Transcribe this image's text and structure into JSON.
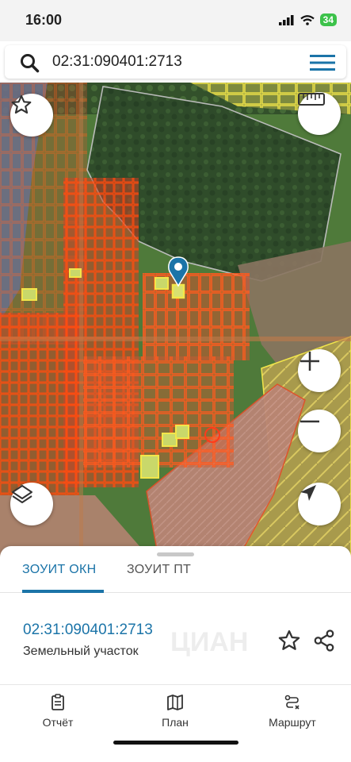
{
  "status_bar": {
    "time": "16:00",
    "battery": "34"
  },
  "search": {
    "query": "02:31:090401:2713"
  },
  "map": {
    "icons": [
      "star-icon",
      "ruler-icon",
      "zoom-in-icon",
      "zoom-out-icon",
      "layers-icon",
      "navigation-icon",
      "location-pin-icon"
    ]
  },
  "sheet": {
    "tabs": [
      {
        "label": "ЗОУИТ ОКН"
      },
      {
        "label": "ЗОУИТ ПТ"
      }
    ],
    "parcel": {
      "number": "02:31:090401:2713",
      "type": "Земельный участок"
    },
    "watermark": "ЦИАН"
  },
  "bottom_nav": [
    {
      "label": "Отчёт",
      "icon": "report-icon"
    },
    {
      "label": "План",
      "icon": "map-icon"
    },
    {
      "label": "Маршрут",
      "icon": "route-icon"
    }
  ],
  "colors": {
    "accent": "#1b74a8",
    "parcel_outline": "#ff5a1f",
    "zone_yellow": "#f2e64a"
  }
}
